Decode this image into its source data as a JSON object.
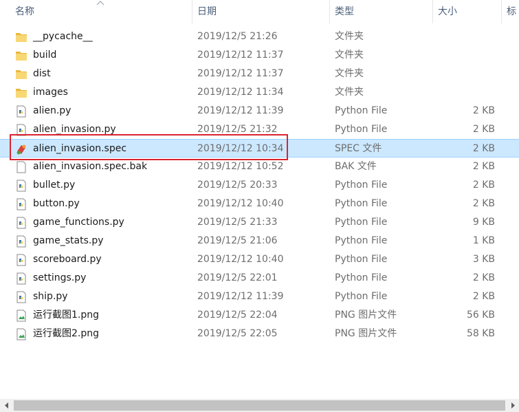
{
  "columns": {
    "name": "名称",
    "date": "日期",
    "type": "类型",
    "size": "大小",
    "tags": "标记"
  },
  "files": [
    {
      "name": "__pycache__",
      "date": "2019/12/5 21:26",
      "type": "文件夹",
      "size": "",
      "icon": "folder-icon"
    },
    {
      "name": "build",
      "date": "2019/12/12 11:37",
      "type": "文件夹",
      "size": "",
      "icon": "folder-icon"
    },
    {
      "name": "dist",
      "date": "2019/12/12 11:37",
      "type": "文件夹",
      "size": "",
      "icon": "folder-icon"
    },
    {
      "name": "images",
      "date": "2019/12/12 11:34",
      "type": "文件夹",
      "size": "",
      "icon": "folder-icon"
    },
    {
      "name": "alien.py",
      "date": "2019/12/12 11:39",
      "type": "Python File",
      "size": "2 KB",
      "icon": "python-file-icon"
    },
    {
      "name": "alien_invasion.py",
      "date": "2019/12/5 21:32",
      "type": "Python File",
      "size": "2 KB",
      "icon": "python-file-icon"
    },
    {
      "name": "alien_invasion.spec",
      "date": "2019/12/12 10:34",
      "type": "SPEC 文件",
      "size": "2 KB",
      "icon": "spec-file-icon"
    },
    {
      "name": "alien_invasion.spec.bak",
      "date": "2019/12/12 10:52",
      "type": "BAK 文件",
      "size": "2 KB",
      "icon": "blank-file-icon"
    },
    {
      "name": "bullet.py",
      "date": "2019/12/5 20:33",
      "type": "Python File",
      "size": "2 KB",
      "icon": "python-file-icon"
    },
    {
      "name": "button.py",
      "date": "2019/12/12 10:40",
      "type": "Python File",
      "size": "2 KB",
      "icon": "python-file-icon"
    },
    {
      "name": "game_functions.py",
      "date": "2019/12/5 21:33",
      "type": "Python File",
      "size": "9 KB",
      "icon": "python-file-icon"
    },
    {
      "name": "game_stats.py",
      "date": "2019/12/5 21:06",
      "type": "Python File",
      "size": "1 KB",
      "icon": "python-file-icon"
    },
    {
      "name": "scoreboard.py",
      "date": "2019/12/12 10:40",
      "type": "Python File",
      "size": "3 KB",
      "icon": "python-file-icon"
    },
    {
      "name": "settings.py",
      "date": "2019/12/5 22:01",
      "type": "Python File",
      "size": "2 KB",
      "icon": "python-file-icon"
    },
    {
      "name": "ship.py",
      "date": "2019/12/12 11:39",
      "type": "Python File",
      "size": "2 KB",
      "icon": "python-file-icon"
    },
    {
      "name": "运行截图1.png",
      "date": "2019/12/5 22:04",
      "type": "PNG 图片文件",
      "size": "56 KB",
      "icon": "png-image-icon"
    },
    {
      "name": "运行截图2.png",
      "date": "2019/12/5 22:05",
      "type": "PNG 图片文件",
      "size": "58 KB",
      "icon": "png-image-icon"
    }
  ],
  "selected_index": 6,
  "colors": {
    "selection": "#cce8ff",
    "highlight_box": "#d9232e",
    "header_text": "#4c607a"
  }
}
